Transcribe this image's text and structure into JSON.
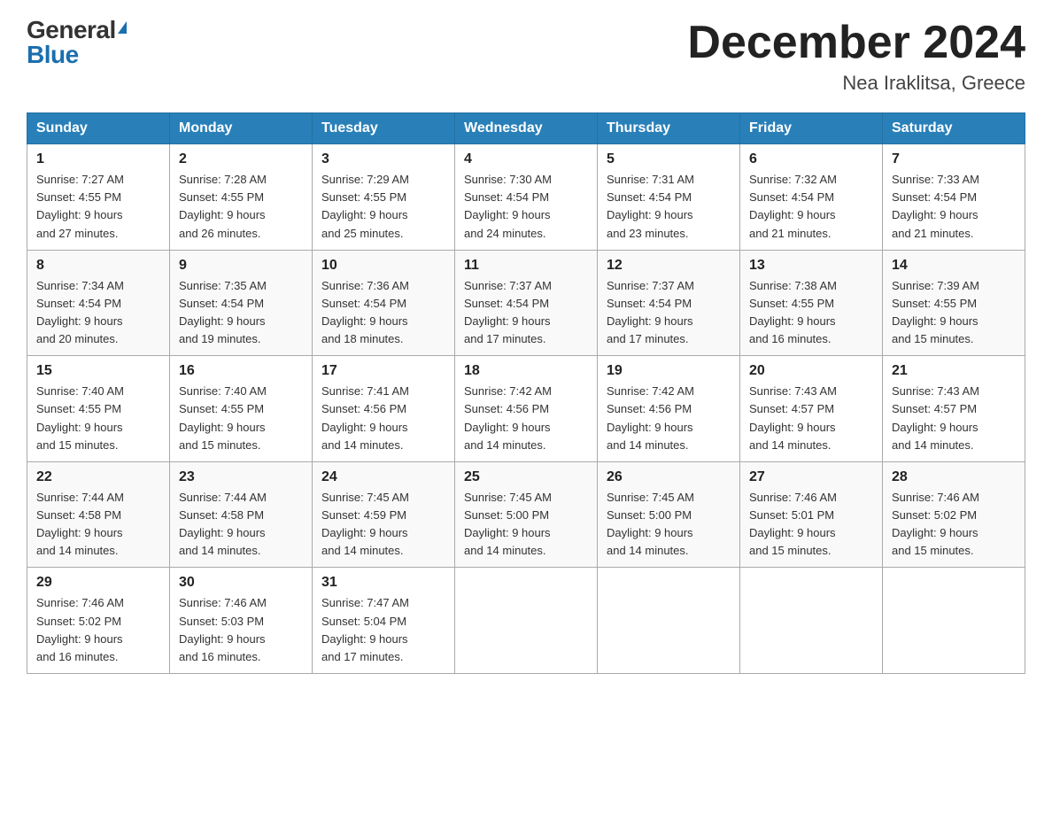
{
  "header": {
    "logo_general": "General",
    "logo_blue": "Blue",
    "month_title": "December 2024",
    "location": "Nea Iraklitsa, Greece"
  },
  "columns": [
    "Sunday",
    "Monday",
    "Tuesday",
    "Wednesday",
    "Thursday",
    "Friday",
    "Saturday"
  ],
  "weeks": [
    [
      {
        "day": "1",
        "sunrise": "7:27 AM",
        "sunset": "4:55 PM",
        "daylight": "9 hours and 27 minutes."
      },
      {
        "day": "2",
        "sunrise": "7:28 AM",
        "sunset": "4:55 PM",
        "daylight": "9 hours and 26 minutes."
      },
      {
        "day": "3",
        "sunrise": "7:29 AM",
        "sunset": "4:55 PM",
        "daylight": "9 hours and 25 minutes."
      },
      {
        "day": "4",
        "sunrise": "7:30 AM",
        "sunset": "4:54 PM",
        "daylight": "9 hours and 24 minutes."
      },
      {
        "day": "5",
        "sunrise": "7:31 AM",
        "sunset": "4:54 PM",
        "daylight": "9 hours and 23 minutes."
      },
      {
        "day": "6",
        "sunrise": "7:32 AM",
        "sunset": "4:54 PM",
        "daylight": "9 hours and 21 minutes."
      },
      {
        "day": "7",
        "sunrise": "7:33 AM",
        "sunset": "4:54 PM",
        "daylight": "9 hours and 21 minutes."
      }
    ],
    [
      {
        "day": "8",
        "sunrise": "7:34 AM",
        "sunset": "4:54 PM",
        "daylight": "9 hours and 20 minutes."
      },
      {
        "day": "9",
        "sunrise": "7:35 AM",
        "sunset": "4:54 PM",
        "daylight": "9 hours and 19 minutes."
      },
      {
        "day": "10",
        "sunrise": "7:36 AM",
        "sunset": "4:54 PM",
        "daylight": "9 hours and 18 minutes."
      },
      {
        "day": "11",
        "sunrise": "7:37 AM",
        "sunset": "4:54 PM",
        "daylight": "9 hours and 17 minutes."
      },
      {
        "day": "12",
        "sunrise": "7:37 AM",
        "sunset": "4:54 PM",
        "daylight": "9 hours and 17 minutes."
      },
      {
        "day": "13",
        "sunrise": "7:38 AM",
        "sunset": "4:55 PM",
        "daylight": "9 hours and 16 minutes."
      },
      {
        "day": "14",
        "sunrise": "7:39 AM",
        "sunset": "4:55 PM",
        "daylight": "9 hours and 15 minutes."
      }
    ],
    [
      {
        "day": "15",
        "sunrise": "7:40 AM",
        "sunset": "4:55 PM",
        "daylight": "9 hours and 15 minutes."
      },
      {
        "day": "16",
        "sunrise": "7:40 AM",
        "sunset": "4:55 PM",
        "daylight": "9 hours and 15 minutes."
      },
      {
        "day": "17",
        "sunrise": "7:41 AM",
        "sunset": "4:56 PM",
        "daylight": "9 hours and 14 minutes."
      },
      {
        "day": "18",
        "sunrise": "7:42 AM",
        "sunset": "4:56 PM",
        "daylight": "9 hours and 14 minutes."
      },
      {
        "day": "19",
        "sunrise": "7:42 AM",
        "sunset": "4:56 PM",
        "daylight": "9 hours and 14 minutes."
      },
      {
        "day": "20",
        "sunrise": "7:43 AM",
        "sunset": "4:57 PM",
        "daylight": "9 hours and 14 minutes."
      },
      {
        "day": "21",
        "sunrise": "7:43 AM",
        "sunset": "4:57 PM",
        "daylight": "9 hours and 14 minutes."
      }
    ],
    [
      {
        "day": "22",
        "sunrise": "7:44 AM",
        "sunset": "4:58 PM",
        "daylight": "9 hours and 14 minutes."
      },
      {
        "day": "23",
        "sunrise": "7:44 AM",
        "sunset": "4:58 PM",
        "daylight": "9 hours and 14 minutes."
      },
      {
        "day": "24",
        "sunrise": "7:45 AM",
        "sunset": "4:59 PM",
        "daylight": "9 hours and 14 minutes."
      },
      {
        "day": "25",
        "sunrise": "7:45 AM",
        "sunset": "5:00 PM",
        "daylight": "9 hours and 14 minutes."
      },
      {
        "day": "26",
        "sunrise": "7:45 AM",
        "sunset": "5:00 PM",
        "daylight": "9 hours and 14 minutes."
      },
      {
        "day": "27",
        "sunrise": "7:46 AM",
        "sunset": "5:01 PM",
        "daylight": "9 hours and 15 minutes."
      },
      {
        "day": "28",
        "sunrise": "7:46 AM",
        "sunset": "5:02 PM",
        "daylight": "9 hours and 15 minutes."
      }
    ],
    [
      {
        "day": "29",
        "sunrise": "7:46 AM",
        "sunset": "5:02 PM",
        "daylight": "9 hours and 16 minutes."
      },
      {
        "day": "30",
        "sunrise": "7:46 AM",
        "sunset": "5:03 PM",
        "daylight": "9 hours and 16 minutes."
      },
      {
        "day": "31",
        "sunrise": "7:47 AM",
        "sunset": "5:04 PM",
        "daylight": "9 hours and 17 minutes."
      },
      null,
      null,
      null,
      null
    ]
  ]
}
